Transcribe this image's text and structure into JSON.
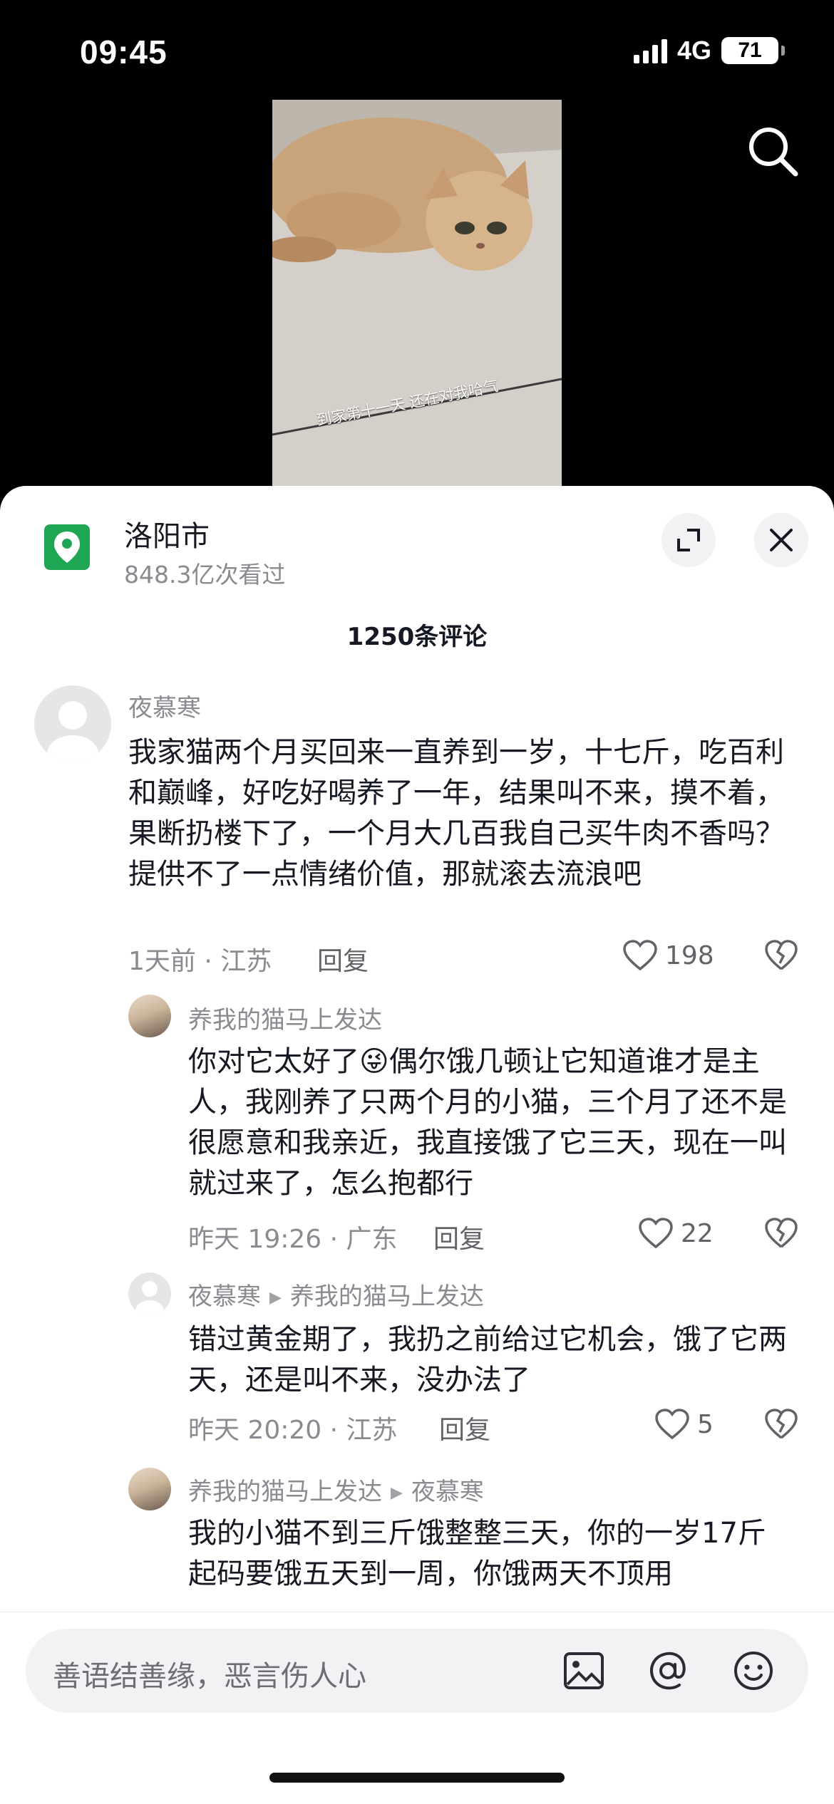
{
  "status_bar": {
    "time": "09:45",
    "network": "4G",
    "battery": "71"
  },
  "video": {
    "caption": "到家第十一天 还在对我哈气"
  },
  "location": {
    "title": "洛阳市",
    "views": "848.3亿次看过"
  },
  "comment_count": "1250条评论",
  "comments": [
    {
      "author": "夜慕寒",
      "text": "我家猫两个月买回来一直养到一岁，十七斤，吃百利和巅峰，好吃好喝养了一年，结果叫不来，摸不着，果断扔楼下了，一个月大几百我自己买牛肉不香吗？提供不了一点情绪价值，那就滚去流浪吧",
      "meta": "1天前 · 江苏",
      "reply_label": "回复",
      "likes": "198"
    },
    {
      "author": "养我的猫马上发达",
      "text_before_emoji": "你对它太好了",
      "emoji": "😜",
      "text_after_emoji": "偶尔饿几顿让它知道谁才是主人，我刚养了只两个月的小猫，三个月了还不是很愿意和我亲近，我直接饿了它三天，现在一叫就过来了，怎么抱都行",
      "meta": "昨天 19:26 · 广东",
      "reply_label": "回复",
      "likes": "22"
    },
    {
      "author": "夜慕寒",
      "reply_to": "养我的猫马上发达",
      "text": "错过黄金期了，我扔之前给过它机会，饿了它两天，还是叫不来，没办法了",
      "meta": "昨天 20:20 · 江苏",
      "reply_label": "回复",
      "likes": "5"
    },
    {
      "author": "养我的猫马上发达",
      "reply_to": "夜慕寒",
      "text": "我的小猫不到三斤饿整整三天，你的一岁17斤起码要饿五天到一周，你饿两天不顶用"
    }
  ],
  "input": {
    "placeholder": "善语结善缘，恶言伤人心"
  }
}
